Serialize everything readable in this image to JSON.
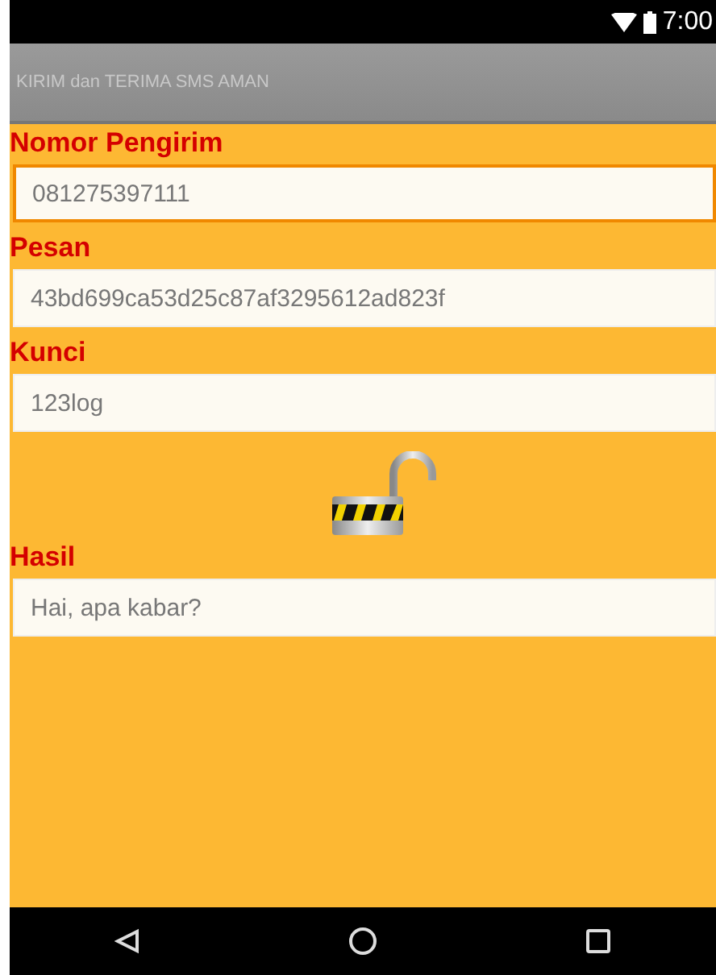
{
  "status_bar": {
    "time": "7:00"
  },
  "app_bar": {
    "title": "KIRIM dan TERIMA SMS AMAN"
  },
  "fields": [
    {
      "label": "Nomor Pengirim",
      "value": "081275397111",
      "focused": true
    },
    {
      "label": "Pesan",
      "value": "43bd699ca53d25c87af3295612ad823f",
      "focused": false
    },
    {
      "label": "Kunci",
      "value": "123log",
      "focused": false
    }
  ],
  "lock": {
    "kind": "unlocked"
  },
  "result": {
    "label": "Hasil",
    "value": "Hai, apa kabar?",
    "focused": false
  }
}
